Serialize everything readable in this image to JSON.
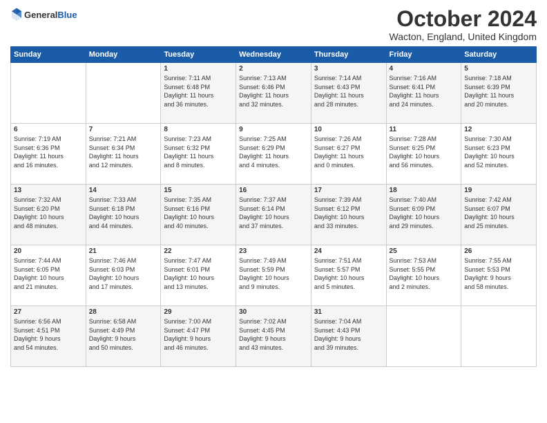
{
  "logo": {
    "line1": "General",
    "line2": "Blue"
  },
  "title": "October 2024",
  "location": "Wacton, England, United Kingdom",
  "weekdays": [
    "Sunday",
    "Monday",
    "Tuesday",
    "Wednesday",
    "Thursday",
    "Friday",
    "Saturday"
  ],
  "weeks": [
    [
      {
        "day": "",
        "content": ""
      },
      {
        "day": "",
        "content": ""
      },
      {
        "day": "1",
        "content": "Sunrise: 7:11 AM\nSunset: 6:48 PM\nDaylight: 11 hours\nand 36 minutes."
      },
      {
        "day": "2",
        "content": "Sunrise: 7:13 AM\nSunset: 6:46 PM\nDaylight: 11 hours\nand 32 minutes."
      },
      {
        "day": "3",
        "content": "Sunrise: 7:14 AM\nSunset: 6:43 PM\nDaylight: 11 hours\nand 28 minutes."
      },
      {
        "day": "4",
        "content": "Sunrise: 7:16 AM\nSunset: 6:41 PM\nDaylight: 11 hours\nand 24 minutes."
      },
      {
        "day": "5",
        "content": "Sunrise: 7:18 AM\nSunset: 6:39 PM\nDaylight: 11 hours\nand 20 minutes."
      }
    ],
    [
      {
        "day": "6",
        "content": "Sunrise: 7:19 AM\nSunset: 6:36 PM\nDaylight: 11 hours\nand 16 minutes."
      },
      {
        "day": "7",
        "content": "Sunrise: 7:21 AM\nSunset: 6:34 PM\nDaylight: 11 hours\nand 12 minutes."
      },
      {
        "day": "8",
        "content": "Sunrise: 7:23 AM\nSunset: 6:32 PM\nDaylight: 11 hours\nand 8 minutes."
      },
      {
        "day": "9",
        "content": "Sunrise: 7:25 AM\nSunset: 6:29 PM\nDaylight: 11 hours\nand 4 minutes."
      },
      {
        "day": "10",
        "content": "Sunrise: 7:26 AM\nSunset: 6:27 PM\nDaylight: 11 hours\nand 0 minutes."
      },
      {
        "day": "11",
        "content": "Sunrise: 7:28 AM\nSunset: 6:25 PM\nDaylight: 10 hours\nand 56 minutes."
      },
      {
        "day": "12",
        "content": "Sunrise: 7:30 AM\nSunset: 6:23 PM\nDaylight: 10 hours\nand 52 minutes."
      }
    ],
    [
      {
        "day": "13",
        "content": "Sunrise: 7:32 AM\nSunset: 6:20 PM\nDaylight: 10 hours\nand 48 minutes."
      },
      {
        "day": "14",
        "content": "Sunrise: 7:33 AM\nSunset: 6:18 PM\nDaylight: 10 hours\nand 44 minutes."
      },
      {
        "day": "15",
        "content": "Sunrise: 7:35 AM\nSunset: 6:16 PM\nDaylight: 10 hours\nand 40 minutes."
      },
      {
        "day": "16",
        "content": "Sunrise: 7:37 AM\nSunset: 6:14 PM\nDaylight: 10 hours\nand 37 minutes."
      },
      {
        "day": "17",
        "content": "Sunrise: 7:39 AM\nSunset: 6:12 PM\nDaylight: 10 hours\nand 33 minutes."
      },
      {
        "day": "18",
        "content": "Sunrise: 7:40 AM\nSunset: 6:09 PM\nDaylight: 10 hours\nand 29 minutes."
      },
      {
        "day": "19",
        "content": "Sunrise: 7:42 AM\nSunset: 6:07 PM\nDaylight: 10 hours\nand 25 minutes."
      }
    ],
    [
      {
        "day": "20",
        "content": "Sunrise: 7:44 AM\nSunset: 6:05 PM\nDaylight: 10 hours\nand 21 minutes."
      },
      {
        "day": "21",
        "content": "Sunrise: 7:46 AM\nSunset: 6:03 PM\nDaylight: 10 hours\nand 17 minutes."
      },
      {
        "day": "22",
        "content": "Sunrise: 7:47 AM\nSunset: 6:01 PM\nDaylight: 10 hours\nand 13 minutes."
      },
      {
        "day": "23",
        "content": "Sunrise: 7:49 AM\nSunset: 5:59 PM\nDaylight: 10 hours\nand 9 minutes."
      },
      {
        "day": "24",
        "content": "Sunrise: 7:51 AM\nSunset: 5:57 PM\nDaylight: 10 hours\nand 5 minutes."
      },
      {
        "day": "25",
        "content": "Sunrise: 7:53 AM\nSunset: 5:55 PM\nDaylight: 10 hours\nand 2 minutes."
      },
      {
        "day": "26",
        "content": "Sunrise: 7:55 AM\nSunset: 5:53 PM\nDaylight: 9 hours\nand 58 minutes."
      }
    ],
    [
      {
        "day": "27",
        "content": "Sunrise: 6:56 AM\nSunset: 4:51 PM\nDaylight: 9 hours\nand 54 minutes."
      },
      {
        "day": "28",
        "content": "Sunrise: 6:58 AM\nSunset: 4:49 PM\nDaylight: 9 hours\nand 50 minutes."
      },
      {
        "day": "29",
        "content": "Sunrise: 7:00 AM\nSunset: 4:47 PM\nDaylight: 9 hours\nand 46 minutes."
      },
      {
        "day": "30",
        "content": "Sunrise: 7:02 AM\nSunset: 4:45 PM\nDaylight: 9 hours\nand 43 minutes."
      },
      {
        "day": "31",
        "content": "Sunrise: 7:04 AM\nSunset: 4:43 PM\nDaylight: 9 hours\nand 39 minutes."
      },
      {
        "day": "",
        "content": ""
      },
      {
        "day": "",
        "content": ""
      }
    ]
  ]
}
